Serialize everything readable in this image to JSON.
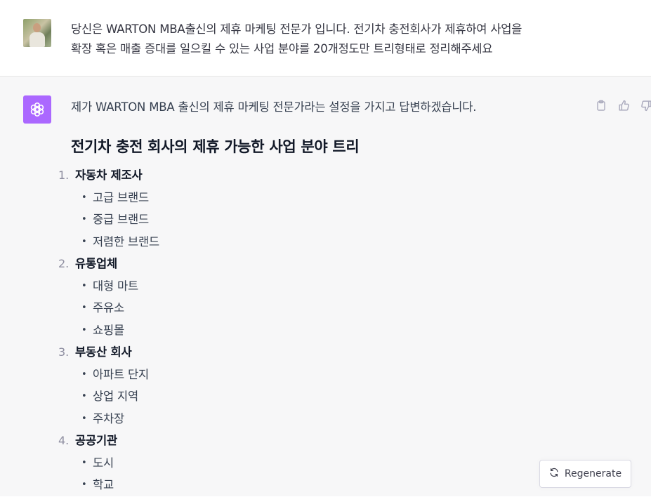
{
  "user_message": {
    "text": "당신은 WARTON MBA출신의 제휴 마케팅 전문가 입니다. 전기차 충전회사가 제휴하여 사업을\n확장 혹은 매출 증대를 일으킬 수 있는 사업 분야를 20개정도만 트리형태로 정리해주세요"
  },
  "assistant_message": {
    "intro": "제가 WARTON MBA 출신의 제휴 마케팅 전문가라는 설정을 가지고 답변하겠습니다.",
    "heading": "전기차 충전 회사의 제휴 가능한 사업 분야 트리",
    "categories": [
      {
        "num": "1.",
        "label": "자동차 제조사",
        "items": [
          "고급 브랜드",
          "중급 브랜드",
          "저렴한 브랜드"
        ]
      },
      {
        "num": "2.",
        "label": "유통업체",
        "items": [
          "대형 마트",
          "주유소",
          "쇼핑몰"
        ]
      },
      {
        "num": "3.",
        "label": "부동산 회사",
        "items": [
          "아파트 단지",
          "상업 지역",
          "주차장"
        ]
      },
      {
        "num": "4.",
        "label": "공공기관",
        "items": [
          "도시",
          "학교"
        ]
      }
    ],
    "actions": [
      "clipboard-icon",
      "thumbs-up-icon",
      "thumbs-down-icon"
    ]
  },
  "regenerate": {
    "label": "Regenerate",
    "icon": "refresh-icon"
  },
  "colors": {
    "assistant_bg": "#f7f7f8",
    "gpt_avatar_bg": "#ab68ff"
  }
}
